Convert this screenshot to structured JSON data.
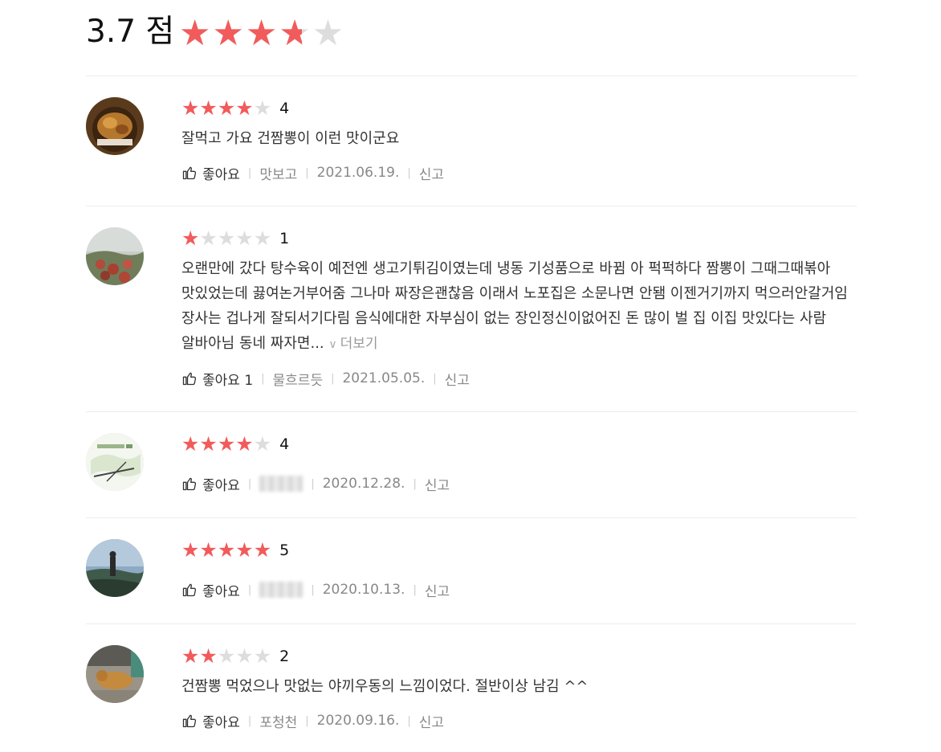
{
  "summary": {
    "score_text": "3.7 점",
    "rating": 3.7,
    "max_rating": 5
  },
  "colors": {
    "star_on": "#f25b5b",
    "star_off": "#dddddd"
  },
  "icons": {
    "like": "thumbs-up-icon",
    "more": "chevron-down-icon"
  },
  "reviews": [
    {
      "rating": 4,
      "rating_text": "4",
      "comment": "잘먹고 가요 건짬뽕이 이런 맛이군요",
      "like_label": "좋아요",
      "author": "맛보고",
      "date": "2021.06.19.",
      "report_label": "신고"
    },
    {
      "rating": 1,
      "rating_text": "1",
      "comment": "오랜만에 갔다 탕수육이 예전엔 생고기튀김이였는데  냉동 기성품으로 바뀜  아 퍽퍽하다     짬뽕이 그때그때볶아 맛있었는데  끓여논거부어줌  그나마 짜장은괜찮음     이래서  노포집은 소문나면 안됌    이젠거기까지 먹으러안갈거임  장사는 겁나게 잘되서기다림  음식에대한 자부심이 없는 장인정신이없어진 돈 많이 벌  집  이집 맛있다는 사람 알바아님 동네 짜자면...",
      "more_label": "더보기",
      "like_label": "좋아요 1",
      "author": "물흐르듯",
      "date": "2021.05.05.",
      "report_label": "신고"
    },
    {
      "rating": 4,
      "rating_text": "4",
      "comment": "",
      "like_label": "좋아요",
      "author": "",
      "date": "2020.12.28.",
      "report_label": "신고"
    },
    {
      "rating": 5,
      "rating_text": "5",
      "comment": "",
      "like_label": "좋아요",
      "author": "",
      "date": "2020.10.13.",
      "report_label": "신고"
    },
    {
      "rating": 2,
      "rating_text": "2",
      "comment": "건짬뽕 먹었으나 맛없는 야끼우동의 느낌이었다.  절반이상 남김 ^^",
      "like_label": "좋아요",
      "author": "포청천",
      "date": "2020.09.16.",
      "report_label": "신고"
    }
  ]
}
